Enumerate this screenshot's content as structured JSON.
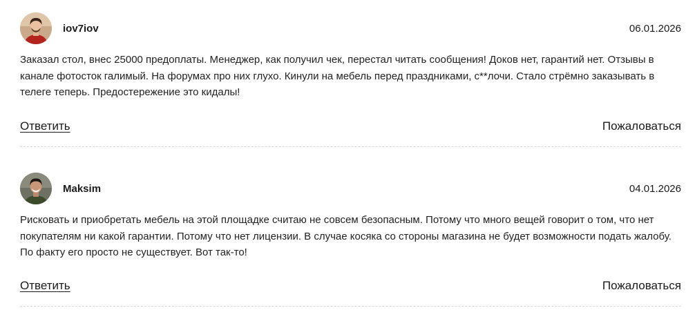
{
  "comments": [
    {
      "author": "iov7iov",
      "date": "06.01.2026",
      "text": "Заказал стол, внес 25000 предоплаты. Менеджер, как получил чек, перестал читать сообщения! Доков нет, гарантий нет. Отзывы в канале фотосток галимый. На форумах про них глухо. Кинули на мебель перед праздниками, с**лочи. Стало стрёмно заказывать в телеге теперь. Предостережение это кидалы!",
      "reply_label": "Ответить",
      "report_label": "Пожаловаться",
      "avatar_icon": "user-avatar-icon"
    },
    {
      "author": "Maksim",
      "date": "04.01.2026",
      "text": "Рисковать и приобретать мебель на этой площадке считаю не совсем безопасным. Потому что много вещей говорит о том, что нет покупателям ни какой гарантии. Потому что нет лицензии. В случае косяка со стороны магазина не будет возможности подать жалобу. По факту его просто не существует. Вот так-то!",
      "reply_label": "Ответить",
      "report_label": "Пожаловаться",
      "avatar_icon": "user-avatar-icon"
    }
  ],
  "colors": {
    "text": "#1a1a1a",
    "divider": "#d9d9d9",
    "background": "#ffffff"
  }
}
